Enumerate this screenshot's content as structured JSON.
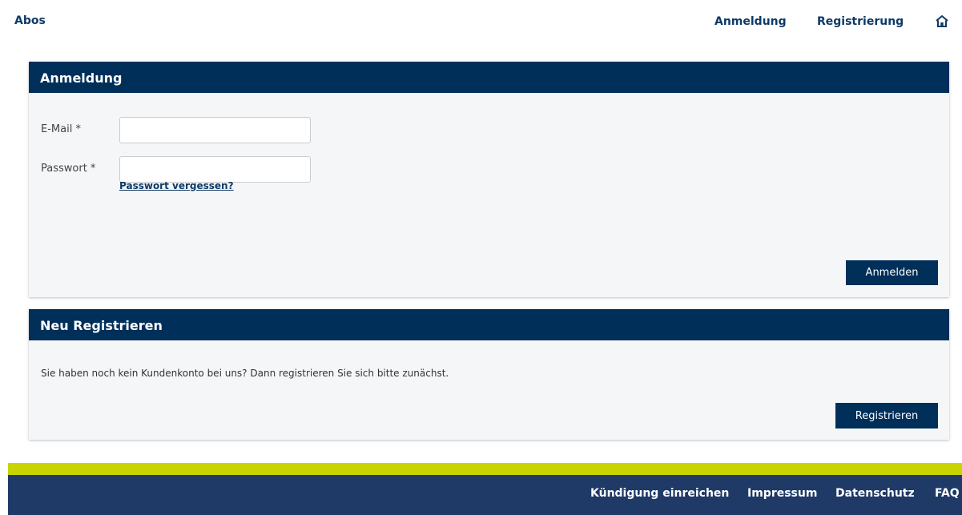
{
  "header": {
    "brand": "Abos",
    "nav": {
      "login": "Anmeldung",
      "register": "Registrierung",
      "home_icon": "home-icon"
    }
  },
  "login_panel": {
    "title": "Anmeldung",
    "email_label": "E-Mail *",
    "email_value": "",
    "password_label": "Passwort *",
    "password_value": "",
    "forgot_link": "Passwort vergessen?",
    "submit_label": "Anmelden"
  },
  "register_panel": {
    "title": "Neu Registrieren",
    "text": "Sie haben noch kein Kundenkonto bei uns? Dann registrieren Sie sich bitte zunächst.",
    "submit_label": "Registrieren"
  },
  "footer": {
    "links": [
      "Kündigung einreichen",
      "Impressum",
      "Datenschutz",
      "FAQ"
    ]
  },
  "colors": {
    "primary": "#002f5a",
    "footer_accent": "#c8d300",
    "footer_bg": "#1f3a66",
    "panel_bg": "#f5f6f8"
  }
}
